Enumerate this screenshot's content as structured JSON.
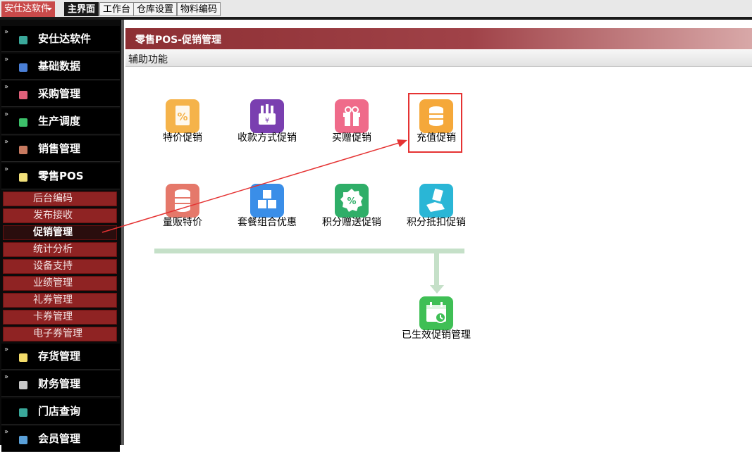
{
  "topbar": {
    "app_menu": "安仕达软件",
    "tabs": [
      {
        "label": "主界面",
        "active": true
      },
      {
        "label": "工作台",
        "active": false
      },
      {
        "label": "仓库设置",
        "active": false
      },
      {
        "label": "物料编码",
        "active": false
      }
    ]
  },
  "sidebar": {
    "items": [
      {
        "label": "安仕达软件",
        "icon": "teal-square-icon",
        "color": "#3aa89a"
      },
      {
        "label": "基础数据",
        "icon": "blue-square-icon",
        "color": "#4a7fd6"
      },
      {
        "label": "采购管理",
        "icon": "pink-square-icon",
        "color": "#e0607a"
      },
      {
        "label": "生产调度",
        "icon": "green-square-icon",
        "color": "#3cc06a"
      },
      {
        "label": "销售管理",
        "icon": "brown-square-icon",
        "color": "#c77a60"
      },
      {
        "label": "零售POS",
        "icon": "yellow-square-icon",
        "color": "#f1e07a"
      },
      {
        "label": "存货管理",
        "icon": "yellow-square-icon",
        "color": "#f3dc6a"
      },
      {
        "label": "财务管理",
        "icon": "gray-square-icon",
        "color": "#c8c8c8"
      },
      {
        "label": "门店查询",
        "icon": "teal-square-icon",
        "color": "#3aa89a"
      },
      {
        "label": "会员管理",
        "icon": "blue-square-icon",
        "color": "#5aa0d8"
      }
    ],
    "sub_items": [
      {
        "label": "后台编码",
        "active": false
      },
      {
        "label": "发布接收",
        "active": false
      },
      {
        "label": "促销管理",
        "active": true
      },
      {
        "label": "统计分析",
        "active": false
      },
      {
        "label": "设备支持",
        "active": false
      },
      {
        "label": "业绩管理",
        "active": false
      },
      {
        "label": "礼券管理",
        "active": false
      },
      {
        "label": "卡券管理",
        "active": false
      },
      {
        "label": "电子券管理",
        "active": false
      }
    ]
  },
  "main": {
    "title": "零售POS-促销管理",
    "aux": "辅助功能",
    "functions": [
      {
        "label": "特价促销",
        "icon": "percent-document-icon",
        "color": "#f5b34a"
      },
      {
        "label": "收款方式促销",
        "icon": "cash-register-icon",
        "color": "#7a3fb0"
      },
      {
        "label": "买赠促销",
        "icon": "gift-icon",
        "color": "#ef6b8a"
      },
      {
        "label": "充值促销",
        "icon": "coins-icon",
        "color": "#f5a83a"
      },
      {
        "label": "量贩特价",
        "icon": "database-icon",
        "color": "#e5786a"
      },
      {
        "label": "套餐组合优惠",
        "icon": "cubes-icon",
        "color": "#3a8ee8"
      },
      {
        "label": "积分赠送促销",
        "icon": "percent-badge-icon",
        "color": "#2fae68"
      },
      {
        "label": "积分抵扣促销",
        "icon": "hand-money-icon",
        "color": "#2ab6d6"
      },
      {
        "label": "已生效促销管理",
        "icon": "calendar-clock-icon",
        "color": "#3fbf55"
      }
    ]
  },
  "colors": {
    "accent_red": "#e53333",
    "flow": "#c5e0c8",
    "sub_item_bg": "#8f2323"
  }
}
